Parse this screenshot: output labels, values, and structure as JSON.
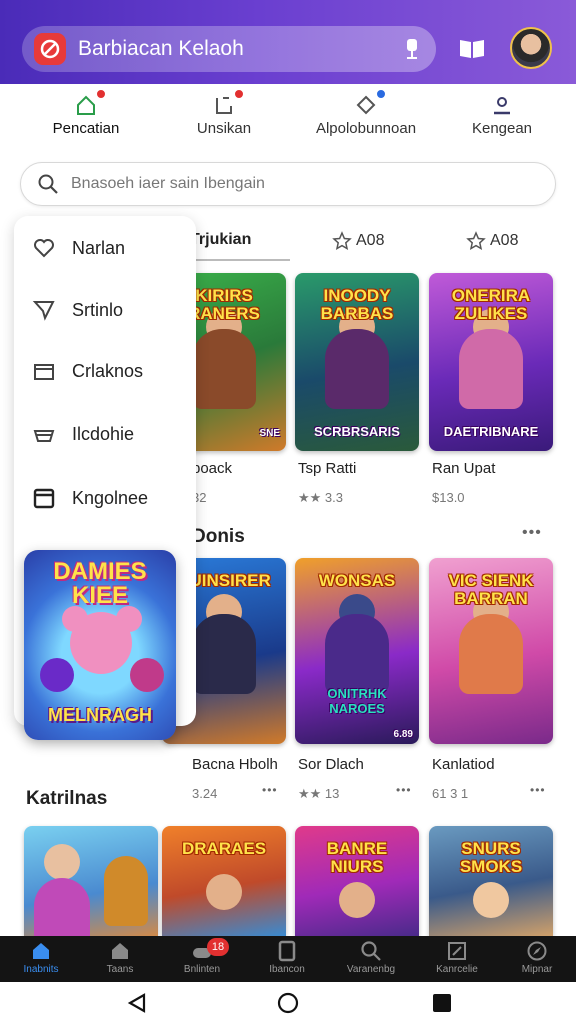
{
  "header": {
    "app_title": "Barbiacan Kelaoh",
    "icons": [
      "app-logo",
      "mic-icon",
      "book-icon",
      "avatar"
    ]
  },
  "tabs": [
    {
      "label": "Pencatian",
      "icon": "home-icon",
      "badge": "red"
    },
    {
      "label": "Unsikan",
      "icon": "download-icon",
      "badge": "red"
    },
    {
      "label": "Alpolobunnoan",
      "icon": "diamond-icon",
      "badge": "blue"
    },
    {
      "label": "Kengean",
      "icon": "profile-icon",
      "badge": ""
    }
  ],
  "search": {
    "placeholder": "Bnasoeh iaer sain Ibengain"
  },
  "sub_tabs": [
    {
      "label": "Trjukian"
    },
    {
      "label": "A08"
    },
    {
      "label": "A08"
    }
  ],
  "drawer": {
    "items": [
      {
        "label": "Narlan",
        "icon": "heart-icon"
      },
      {
        "label": "Srtinlo",
        "icon": "send-icon"
      },
      {
        "label": "Crlaknos",
        "icon": "folder-icon"
      },
      {
        "label": "Ilcdohie",
        "icon": "bowl-icon"
      },
      {
        "label": "Kngolnee",
        "icon": "box-icon"
      }
    ],
    "promo": {
      "title": "DAMIES KIEE",
      "bottom": "MELNRAGH"
    }
  },
  "row1": [
    {
      "name": "boack",
      "meta": "32",
      "card_title": "KIRIRS RANERS",
      "card_bottom": "",
      "card_tag": "SNE"
    },
    {
      "name": "Tsp Ratti",
      "meta": "★★ 3.3",
      "card_title": "INOODY BARBAS",
      "card_bottom": "SCRBRSARIS",
      "card_tag": ""
    },
    {
      "name": "Ran Upat",
      "meta": "$13.0",
      "card_title": "ONERIRA ZULIKES",
      "card_bottom": "DAETRIBNARE",
      "card_tag": ""
    }
  ],
  "section2": {
    "title": "Donis"
  },
  "row2": [
    {
      "name": "Bacna Hbolh",
      "meta": "3.24",
      "card_title": "BUINSIRER",
      "card_bottom": "",
      "card_tag": ""
    },
    {
      "name": "Sor Dlach",
      "meta": "★★ 13",
      "card_title": "WONSAS",
      "card_bottom": "ONITRHK NAROES",
      "card_tag": "6.89"
    },
    {
      "name": "Kanlatiod",
      "meta": "61 3 1",
      "card_title": "VIC SIENK BARRAN",
      "card_bottom": "",
      "card_tag": ""
    }
  ],
  "section3": {
    "title": "Katrilnas"
  },
  "row3": [
    {
      "card_title": ""
    },
    {
      "card_title": "DRARAES"
    },
    {
      "card_title": "BANRE NIURS"
    },
    {
      "card_title": "SNURS SMOKS"
    }
  ],
  "bottom_nav": [
    {
      "label": "Inabnits",
      "icon": "home-icon"
    },
    {
      "label": "Taans",
      "icon": "store-icon"
    },
    {
      "label": "Bnlinten",
      "icon": "gamepad-icon",
      "badge": "18"
    },
    {
      "label": "Ibancon",
      "icon": "tablet-icon"
    },
    {
      "label": "Varanenbg",
      "icon": "search-icon"
    },
    {
      "label": "Kanrcelie",
      "icon": "frame-icon"
    },
    {
      "label": "Mipnar",
      "icon": "compass-icon"
    }
  ],
  "colors": {
    "header_start": "#4a2bb8",
    "header_end": "#8a5ad8",
    "accent_blue": "#3a8ef0",
    "badge_red": "#e23030",
    "bottom_nav_bg": "#141414"
  }
}
